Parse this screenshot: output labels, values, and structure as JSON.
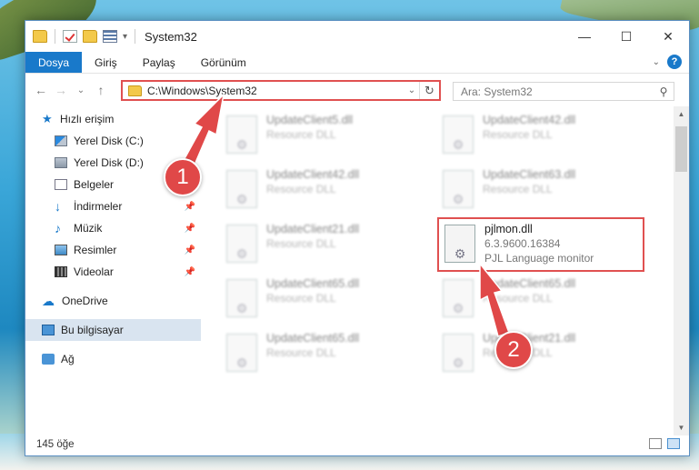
{
  "window": {
    "title": "System32",
    "controls": {
      "minimize": "—",
      "maximize": "☐",
      "close": "✕"
    }
  },
  "ribbon": {
    "tabs": [
      "Dosya",
      "Giriş",
      "Paylaş",
      "Görünüm"
    ],
    "active_tab": "Dosya",
    "help": "?",
    "collapse": "⌄"
  },
  "nav": {
    "back": "←",
    "forward": "→",
    "recent": "⌄",
    "up": "↑",
    "address": "C:\\Windows\\System32",
    "refresh": "↻",
    "dropdown": "⌄",
    "search_placeholder": "Ara: System32",
    "search_icon": "search-icon"
  },
  "sidebar": {
    "quick_access": "Hızlı erişim",
    "items": [
      {
        "label": "Yerel Disk (C:)",
        "icon": "drive-c-icon",
        "pinned": false
      },
      {
        "label": "Yerel Disk (D:)",
        "icon": "drive-icon",
        "pinned": false
      },
      {
        "label": "Belgeler",
        "icon": "documents-icon",
        "pinned": false
      },
      {
        "label": "İndirmeler",
        "icon": "downloads-icon",
        "pinned": true
      },
      {
        "label": "Müzik",
        "icon": "music-icon",
        "pinned": true
      },
      {
        "label": "Resimler",
        "icon": "pictures-icon",
        "pinned": true
      },
      {
        "label": "Videolar",
        "icon": "videos-icon",
        "pinned": true
      }
    ],
    "onedrive": "OneDrive",
    "this_pc": "Bu bilgisayar",
    "network": "Ağ"
  },
  "files": [
    {
      "name": "UpdateClient5.dll",
      "sub": "Resource DLL"
    },
    {
      "name": "UpdateClient42.dll",
      "sub": "Resource DLL"
    },
    {
      "name": "UpdateClient42.dll",
      "sub": "Resource DLL"
    },
    {
      "name": "UpdateClient63.dll",
      "sub": "Resource DLL"
    },
    {
      "name": "UpdateClient21.dll",
      "sub": "Resource DLL"
    },
    {
      "name": "pjlmon.dll",
      "version": "6.3.9600.16384",
      "sub": "PJL Language monitor"
    },
    {
      "name": "UpdateClient65.dll",
      "sub": "Resource DLL"
    },
    {
      "name": "UpdateClient65.dll",
      "sub": "Resource DLL"
    },
    {
      "name": "UpdateClient65.dll",
      "sub": "Resource DLL"
    },
    {
      "name": "UpdateClient21.dll",
      "sub": "Resource DLL"
    }
  ],
  "status": {
    "count": "145 öğe"
  },
  "callouts": {
    "one": "1",
    "two": "2"
  },
  "colors": {
    "accent": "#1979ca",
    "highlight": "#e05050"
  }
}
